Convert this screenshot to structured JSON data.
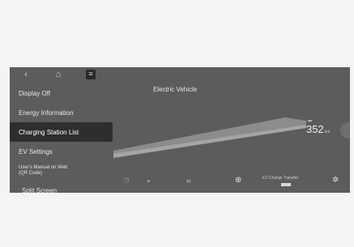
{
  "window": {
    "title": "Electric Vehicle"
  },
  "topbar": {
    "back_glyph": "‹",
    "home_glyph": "⌂",
    "menu_glyph": "≡"
  },
  "menu": {
    "items": [
      {
        "label": "Display Off"
      },
      {
        "label": "Energy Information"
      },
      {
        "label": "Charging Station List",
        "active": true
      },
      {
        "label": "EV Settings"
      },
      {
        "label": "User's Manual on Web",
        "label2": "(QR Code)"
      },
      {
        "label": "Split Screen"
      }
    ]
  },
  "range": {
    "value": "352",
    "unit": "km"
  },
  "bottom": {
    "ev_charge_transfer": "EV Charge Transfer"
  },
  "colors": {
    "screen_bg": "#5c5c5c",
    "active_bg": "#2e2e2e",
    "text": "#e6e6e6"
  },
  "icons": [
    "back-icon",
    "home-icon",
    "menu-icon",
    "plus-icon",
    "gear-icon"
  ]
}
